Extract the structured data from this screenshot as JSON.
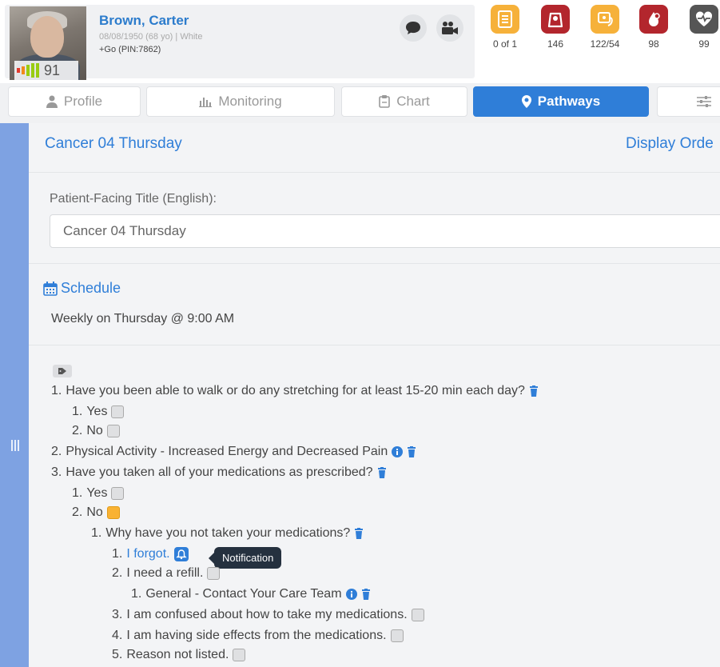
{
  "patient": {
    "name": "Brown, Carter",
    "dob_line": "08/08/1950 (68 yo) | White",
    "program": "+Go (PIN:7862)",
    "score": "91",
    "score_color": "#99cc11"
  },
  "header_actions": [
    {
      "icon": "chat-bubble-icon"
    },
    {
      "icon": "video-camera-icon"
    }
  ],
  "stats": [
    {
      "icon": "checklist-icon",
      "value": "0 of 1",
      "color": "#f6b13a"
    },
    {
      "icon": "weight-scale-icon",
      "value": "146",
      "color": "#b3262d"
    },
    {
      "icon": "blood-pressure-icon",
      "value": "122/54",
      "color": "#f6b13a"
    },
    {
      "icon": "blood-drop-icon",
      "value": "98",
      "color": "#b3262d"
    },
    {
      "icon": "heart-rate-icon",
      "value": "99",
      "color": "#555555"
    }
  ],
  "tabs": [
    {
      "label": "Profile",
      "icon": "person-icon"
    },
    {
      "label": "Monitoring",
      "icon": "bar-chart-icon"
    },
    {
      "label": "Chart",
      "icon": "clipboard-icon"
    },
    {
      "label": "Pathways",
      "icon": "map-pin-icon",
      "active": true
    },
    {
      "label": "",
      "icon": "sliders-icon"
    }
  ],
  "pathway": {
    "title": "Cancer 04 Thursday",
    "display_order_label": "Display Orde",
    "facing_label": "Patient-Facing Title (English):",
    "facing_value": "Cancer 04 Thursday",
    "schedule_label": "Schedule",
    "schedule_text": "Weekly on Thursday @ 9:00 AM"
  },
  "tree": {
    "q1": {
      "num": "1.",
      "text": "Have you been able to walk or do any stretching for at least 15-20 min each day?"
    },
    "q1a": {
      "num": "1.",
      "text": "Yes"
    },
    "q1b": {
      "num": "2.",
      "text": "No"
    },
    "q2": {
      "num": "2.",
      "text": "Physical Activity - Increased Energy and Decreased Pain"
    },
    "q3": {
      "num": "3.",
      "text": "Have you taken all of your medications as prescribed?"
    },
    "q3a": {
      "num": "1.",
      "text": "Yes"
    },
    "q3b": {
      "num": "2.",
      "text": "No"
    },
    "q3b1": {
      "num": "1.",
      "text": "Why have you not taken your medications?"
    },
    "r1": {
      "num": "1.",
      "text": "I forgot."
    },
    "r2": {
      "num": "2.",
      "text": "I need a refill."
    },
    "r2a": {
      "num": "1.",
      "text": "General - Contact Your Care Team"
    },
    "r3": {
      "num": "3.",
      "text": "I am confused about how to take my medications."
    },
    "r4": {
      "num": "4.",
      "text": "I am having side effects from the medications."
    },
    "r5": {
      "num": "5.",
      "text": "Reason not listed."
    },
    "tooltip": "Notification"
  },
  "colors": {
    "accent": "#2f7ed8",
    "left_strip": "#7ea2e2",
    "orange": "#f9b233"
  }
}
